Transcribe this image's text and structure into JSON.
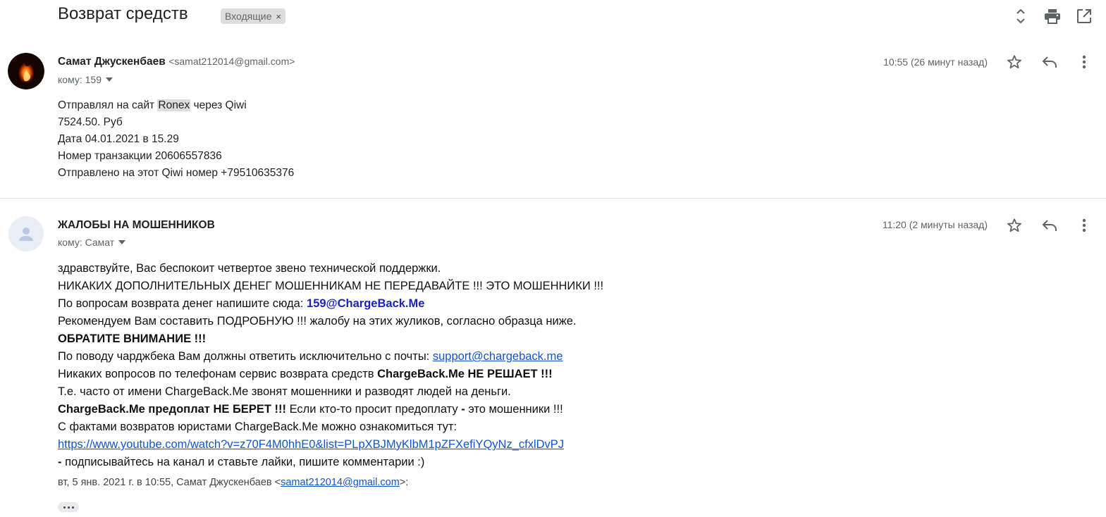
{
  "thread": {
    "subject": "Возврат средств",
    "label": "Входящие",
    "label_remove": "×"
  },
  "icons": {
    "expand": "unfold-icon",
    "print": "print-icon",
    "newwindow": "open-in-new-window-icon"
  },
  "message1": {
    "sender_name": "Самат Джускенбаев",
    "sender_email": "<samat212014@gmail.com>",
    "to": "кому: 159",
    "time": "10:55 (26 минут назад)",
    "lines": {
      "l1a": "Отправлял на сайт ",
      "l1b": "Ronex",
      "l1c": " через Qiwi",
      "l2": "7524.50. Руб",
      "l3": "Дата 04.01.2021 в 15.29",
      "l4": "Номер транзакции 20606557836",
      "l5": "Отправлено на этот Qiwi номер +79510635376"
    }
  },
  "message2": {
    "sender_name": "ЖАЛОБЫ НА МОШЕННИКОВ",
    "to": "кому: Самат",
    "time": "11:20 (2 минуты назад)",
    "lines": {
      "l1": "здравствуйте, Вас беспокоит четвертое звено технической поддержки.",
      "l2": "НИКАКИХ ДОПОЛНИТЕЛЬНЫХ ДЕНЕГ МОШЕННИКАМ НЕ ПЕРЕДАВАЙТЕ !!! ЭТО МОШЕННИКИ !!!",
      "l3a": "По вопросам возврата денег напишите сюда: ",
      "l3b": "159@ChargeBack.Me",
      "l4": "Рекомендуем Вам составить ПОДРОБНУЮ !!! жалобу на этих жуликов, согласно образца ниже.",
      "l5": "ОБРАТИТЕ ВНИМАНИЕ !!!",
      "l6a": "По поводу чарджбека Вам должны ответить исключительно с почты: ",
      "l6b": "support@chargeback.me",
      "l7a": "Никаких вопросов по телефонам сервис возврата средств ",
      "l7b": "ChargeBack.Me НЕ РЕШАЕТ !!!",
      "l8": "Т.е. часто от имени ChargeBack.Me звонят мошенники и разводят людей на деньги.",
      "l9a": "ChargeBack.Me предоплат НЕ БЕРЕТ !!!",
      "l9b": " Если кто-то просит предоплату ",
      "l9c": "-",
      "l9d": " это мошенники !!!",
      "l10": "С фактами возвратов юристами ChargeBack.Me можно ознакомиться тут:",
      "l11": "https://www.youtube.com/watch?v=z70F4M0hhE0&list=PLpXBJMyKlbM1pZFXefiYQyNz_cfxlDvPJ",
      "l12a": " -",
      "l12b": " подписывайтесь на канал и ставьте лайки, пишите комментарии :)"
    },
    "quote": {
      "prefix": "вт, 5 янв. 2021 г. в 10:55, Самат Джускенбаев <",
      "email": "samat212014@gmail.com",
      "suffix": ">:"
    }
  },
  "colors": {
    "accent_link": "#1155cc",
    "blue_bold": "#1a24b8",
    "label_bg": "#dddddd"
  }
}
